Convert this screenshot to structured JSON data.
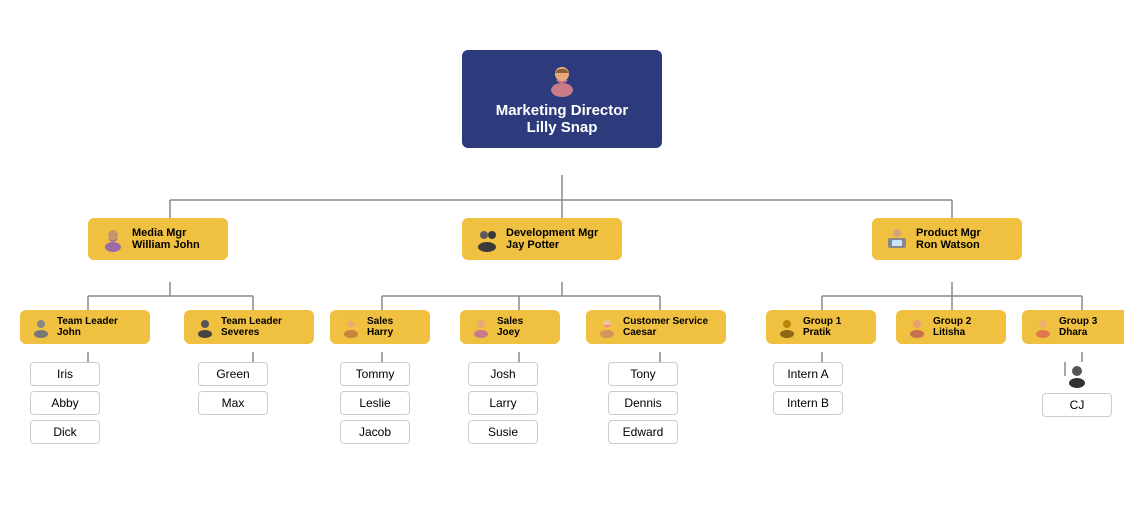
{
  "root": {
    "title": "Marketing Director\nLilly Snap",
    "title_line1": "Marketing Director",
    "title_line2": "Lilly Snap",
    "avatar": "female"
  },
  "level1": [
    {
      "id": "media",
      "title": "Media Mgr",
      "name": "William John",
      "avatar": "female2"
    },
    {
      "id": "dev",
      "title": "Development Mgr",
      "name": "Jay Potter",
      "avatar": "male"
    },
    {
      "id": "product",
      "title": "Product Mgr",
      "name": "Ron Watson",
      "avatar": "laptop"
    }
  ],
  "level2": {
    "media": [
      {
        "id": "tl_john",
        "title": "Team Leader",
        "name": "John",
        "avatar": "male2"
      },
      {
        "id": "tl_severes",
        "title": "Team Leader",
        "name": "Severes",
        "avatar": "male3"
      }
    ],
    "dev": [
      {
        "id": "sales_harry",
        "title": "Sales",
        "name": "Harry",
        "avatar": "flower"
      },
      {
        "id": "sales_joey",
        "title": "Sales",
        "name": "Joey",
        "avatar": "female3"
      },
      {
        "id": "cs_caesar",
        "title": "Customer Service",
        "name": "Caesar",
        "avatar": "female4"
      }
    ],
    "product": [
      {
        "id": "grp1",
        "title": "Group 1",
        "name": "Pratik",
        "avatar": "male4"
      },
      {
        "id": "grp2",
        "title": "Group 2",
        "name": "Litisha",
        "avatar": "female5"
      },
      {
        "id": "grp3",
        "title": "Group 3",
        "name": "Dhara",
        "avatar": "female6"
      }
    ]
  },
  "level3": {
    "tl_john": [
      "Iris",
      "Abby",
      "Dick"
    ],
    "tl_severes": [
      "Green",
      "Max"
    ],
    "sales_harry": [
      "Tommy",
      "Leslie",
      "Jacob"
    ],
    "sales_joey": [
      "Josh",
      "Larry",
      "Susie"
    ],
    "cs_caesar": [
      "Tony",
      "Dennis",
      "Edward"
    ],
    "grp1": [
      "Intern A",
      "Intern B"
    ],
    "grp2": [],
    "grp3": [
      "CJ"
    ]
  },
  "colors": {
    "root_bg": "#2d3b7c",
    "root_text": "#ffffff",
    "mgr_bg": "#f0c040",
    "leaf_border": "#cccccc",
    "connector": "#888888"
  }
}
